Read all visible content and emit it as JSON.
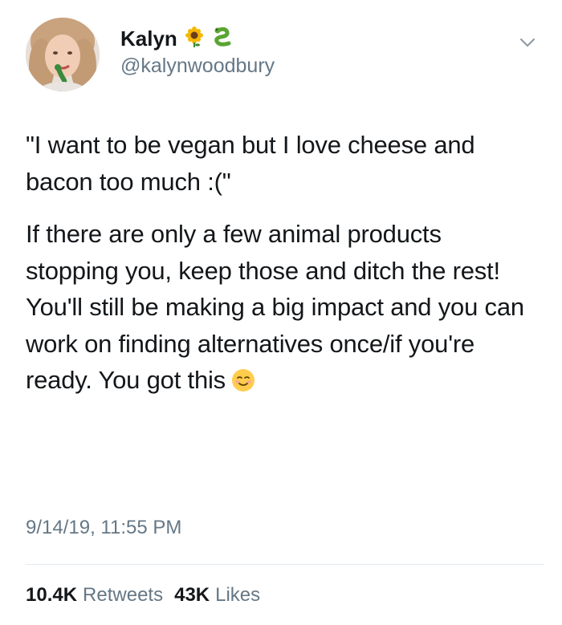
{
  "author": {
    "display_name": "Kalyn",
    "handle": "@kalynwoodbury",
    "name_emojis": [
      "sunflower-icon",
      "snake-icon"
    ]
  },
  "tweet": {
    "paragraph_1": "\"I want to be vegan but I love cheese and bacon too much :(\"",
    "paragraph_2": "If there are only a few animal products stopping you, keep those and ditch the rest! You'll still be making a big impact and you can work on finding alternatives once/if you're ready. You got this",
    "trailing_emoji": "smiling-face-icon",
    "timestamp": "9/14/19, 11:55 PM"
  },
  "stats": {
    "retweets_count": "10.4K",
    "retweets_label": "Retweets",
    "likes_count": "43K",
    "likes_label": "Likes"
  },
  "colors": {
    "text_primary": "#14171a",
    "text_secondary": "#657786",
    "divider": "#e1e8ed"
  }
}
